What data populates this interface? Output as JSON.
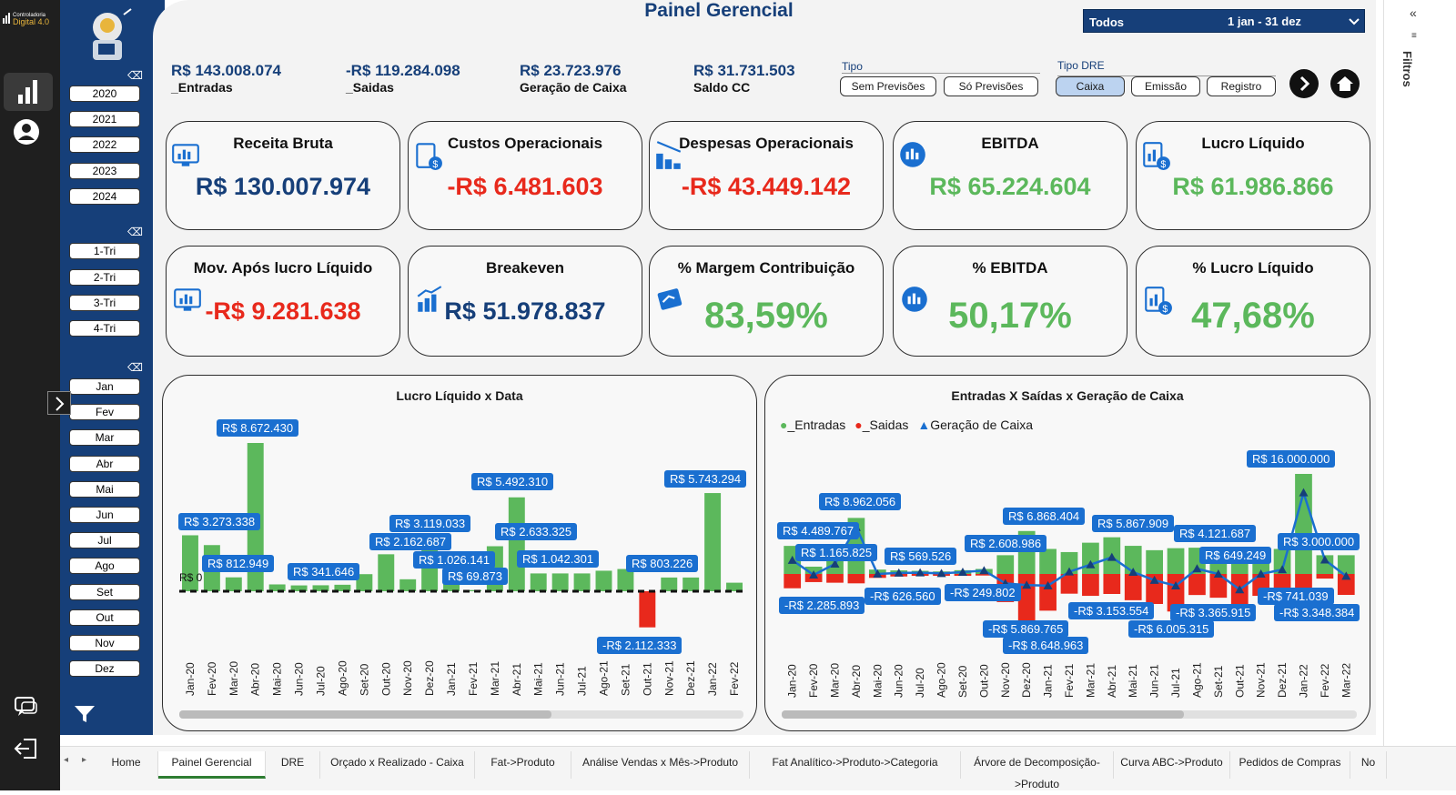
{
  "header": {
    "title": "Painel Gerencial",
    "brand": "Controladoria Digital 4.0",
    "date_filter": {
      "label": "Todos",
      "range": "1 jan - 31 dez"
    }
  },
  "totals": [
    {
      "amount": "R$ 143.008.074",
      "label": "_Entradas"
    },
    {
      "amount": "-R$ 119.284.098",
      "label": "_Saidas"
    },
    {
      "amount": "R$ 23.723.976",
      "label": "Geração de Caixa"
    },
    {
      "amount": "R$ 31.731.503",
      "label": "Saldo CC"
    }
  ],
  "tipo": {
    "label": "Tipo",
    "options": [
      "Sem Previsões",
      "Só Previsões"
    ]
  },
  "tipo_dre": {
    "label": "Tipo DRE",
    "options": [
      "Caixa",
      "Emissão",
      "Registro"
    ],
    "selected": "Caixa"
  },
  "years": [
    "2020",
    "2021",
    "2022",
    "2023",
    "2024"
  ],
  "quarters": [
    "1-Tri",
    "2-Tri",
    "3-Tri",
    "4-Tri"
  ],
  "months": [
    "Jan",
    "Fev",
    "Mar",
    "Abr",
    "Mai",
    "Jun",
    "Jul",
    "Ago",
    "Set",
    "Out",
    "Nov",
    "Dez"
  ],
  "cards_row1": [
    {
      "title": "Receita Bruta",
      "value": "R$ 130.007.974",
      "color": "#163f79",
      "icon": "monitor-chart-icon"
    },
    {
      "title": "Custos Operacionais",
      "value": "-R$ 6.481.603",
      "color": "#e8291c",
      "icon": "clipboard-dollar-icon"
    },
    {
      "title": "Despesas Operacionais",
      "value": "-R$ 43.449.142",
      "color": "#e8291c",
      "icon": "bar-chart-down-icon"
    },
    {
      "title": "EBITDA",
      "value": "R$ 65.224.604",
      "color": "#5cb85c",
      "icon": "chat-chart-icon"
    },
    {
      "title": "Lucro Líquido",
      "value": "R$ 61.986.866",
      "color": "#5cb85c",
      "icon": "report-dollar-icon"
    }
  ],
  "cards_row2": [
    {
      "title": "Mov. Após lucro Líquido",
      "value": "-R$ 9.281.638",
      "color": "#e8291c",
      "icon": "monitor-chart-icon"
    },
    {
      "title": "Breakeven",
      "value": "R$ 51.978.837",
      "color": "#163f79",
      "icon": "growth-bars-icon"
    },
    {
      "title": "% Margem Contribuição",
      "value": "83,59%",
      "color": "#5cb85c",
      "icon": "card-chart-icon"
    },
    {
      "title": "% EBITDA",
      "value": "50,17%",
      "color": "#5cb85c",
      "icon": "chat-chart-icon"
    },
    {
      "title": "% Lucro Líquido",
      "value": "47,68%",
      "color": "#5cb85c",
      "icon": "report-dollar-icon"
    }
  ],
  "colors": {
    "navy": "#163f79",
    "red": "#e8291c",
    "green": "#5cb85c",
    "label_blue": "#1a6fd0"
  },
  "filtros_label": "Filtros",
  "tabs": [
    "Home",
    "Painel Gerencial",
    "DRE",
    "Orçado x Realizado - Caixa",
    "Fat->Produto",
    "Análise Vendas x Mês->Produto",
    "Fat Analítico->Produto->Categoria",
    "Árvore de Decomposição->Produto",
    "Curva ABC->Produto",
    "Pedidos de Compras",
    "No"
  ],
  "active_tab": "Painel Gerencial",
  "chart_data": [
    {
      "type": "bar",
      "title": "Lucro Líquido x Data",
      "zero_label": "R$ 0",
      "categories": [
        "Jan-20",
        "Fev-20",
        "Mar-20",
        "Abr-20",
        "Mai-20",
        "Jun-20",
        "Jul-20",
        "Ago-20",
        "Set-20",
        "Out-20",
        "Nov-20",
        "Dez-20",
        "Jan-21",
        "Fev-21",
        "Mar-21",
        "Abr-21",
        "Mai-21",
        "Jun-21",
        "Jul-21",
        "Ago-21",
        "Set-21",
        "Out-21",
        "Nov-21",
        "Dez-21",
        "Jan-22",
        "Fev-22"
      ],
      "values": [
        3273338,
        2700000,
        812949,
        8672430,
        400000,
        341646,
        350000,
        380000,
        1000000,
        2162687,
        700000,
        3119033,
        1026141,
        69873,
        2633325,
        5492310,
        1042301,
        1042301,
        1042301,
        1200000,
        1300000,
        -2112333,
        803226,
        803226,
        5743294,
        500000
      ],
      "labels": [
        {
          "index": 0,
          "text": "R$ 3.273.338"
        },
        {
          "index": 2,
          "text": "R$ 812.949"
        },
        {
          "index": 3,
          "text": "R$ 8.672.430"
        },
        {
          "index": 5,
          "text": "R$ 341.646"
        },
        {
          "index": 9,
          "text": "R$ 2.162.687"
        },
        {
          "index": 11,
          "text": "R$ 3.119.033"
        },
        {
          "index": 12,
          "text": "R$ 1.026.141"
        },
        {
          "index": 13,
          "text": "R$ 69.873"
        },
        {
          "index": 15,
          "text": "R$ 5.492.310"
        },
        {
          "index": 16,
          "text": "R$ 2.633.325"
        },
        {
          "index": 17,
          "text": "R$ 1.042.301"
        },
        {
          "index": 21,
          "text": "-R$ 2.112.333"
        },
        {
          "index": 22,
          "text": "R$ 803.226"
        },
        {
          "index": 24,
          "text": "R$ 5.743.294"
        }
      ],
      "color_pos": "#5cb85c",
      "color_neg": "#e8291c"
    },
    {
      "type": "bar",
      "title": "Entradas X Saídas x Geração de Caixa",
      "legend": [
        "_Entradas",
        "_Saidas",
        "Geração de Caixa"
      ],
      "categories": [
        "Jan-20",
        "Fev-20",
        "Mar-20",
        "Abr-20",
        "Mai-20",
        "Jun-20",
        "Jul-20",
        "Ago-20",
        "Set-20",
        "Out-20",
        "Nov-20",
        "Dez-20",
        "Jan-21",
        "Fev-21",
        "Mar-21",
        "Abr-21",
        "Mai-21",
        "Jun-21",
        "Jul-21",
        "Ago-21",
        "Set-21",
        "Out-21",
        "Nov-21",
        "Dez-21",
        "Jan-22",
        "Fev-22",
        "Mar-22"
      ],
      "series": [
        {
          "name": "_Entradas",
          "values": [
            4489767,
            1165825,
            3000000,
            8962056,
            700000,
            569526,
            500000,
            400000,
            600000,
            800000,
            3000000,
            6868404,
            4000000,
            3500000,
            5000000,
            5867909,
            4500000,
            3800000,
            4121687,
            4200000,
            3800000,
            2500000,
            3500000,
            4000000,
            16000000,
            3000000,
            3000000
          ]
        },
        {
          "name": "_Saidas",
          "values": [
            -2285893,
            -1300000,
            -1400000,
            -1500000,
            -626560,
            -400000,
            -300000,
            -300000,
            -300000,
            -249802,
            -4500000,
            -8648963,
            -5869765,
            -3153554,
            -3500000,
            -3200000,
            -4200000,
            -4800000,
            -6005315,
            -3365915,
            -3800000,
            -5000000,
            -3500000,
            -3300000,
            -3000000,
            -741039,
            -3348384
          ]
        },
        {
          "name": "Geração de Caixa",
          "values": [
            2203874,
            -150000,
            1600000,
            7462056,
            0,
            169526,
            200000,
            100000,
            300000,
            550000,
            -1500000,
            -1780559,
            -1869765,
            346446,
            1500000,
            2667909,
            300000,
            -1000000,
            -1883628,
            834085,
            0,
            -2500000,
            0,
            700000,
            13000000,
            2258961,
            -348384
          ]
        }
      ],
      "labels": [
        {
          "text": "R$ 8.962.056"
        },
        {
          "text": "R$ 4.489.767"
        },
        {
          "text": "R$ 1.165.825"
        },
        {
          "text": "R$ 569.526"
        },
        {
          "text": "R$ 2.608.986"
        },
        {
          "text": "R$ 6.868.404"
        },
        {
          "text": "R$ 5.867.909"
        },
        {
          "text": "R$ 4.121.687"
        },
        {
          "text": "R$ 649.249"
        },
        {
          "text": "R$ 16.000.000"
        },
        {
          "text": "R$ 3.000.000"
        },
        {
          "text": "-R$ 2.285.893"
        },
        {
          "text": "-R$ 626.560"
        },
        {
          "text": "-R$ 249.802"
        },
        {
          "text": "-R$ 3.153.554"
        },
        {
          "text": "-R$ 5.869.765"
        },
        {
          "text": "-R$ 8.648.963"
        },
        {
          "text": "-R$ 3.365.915"
        },
        {
          "text": "-R$ 6.005.315"
        },
        {
          "text": "-R$ 741.039"
        },
        {
          "text": "-R$ 3.348.384"
        }
      ],
      "colors": {
        "_Entradas": "#5cb85c",
        "_Saidas": "#e8291c",
        "Geração de Caixa": "#1a6fd0"
      }
    }
  ]
}
